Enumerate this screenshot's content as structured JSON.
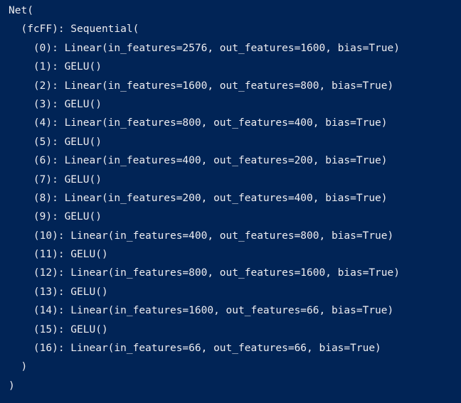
{
  "terminal": {
    "lines": [
      "Net(",
      "  (fcFF): Sequential(",
      "    (0): Linear(in_features=2576, out_features=1600, bias=True)",
      "    (1): GELU()",
      "    (2): Linear(in_features=1600, out_features=800, bias=True)",
      "    (3): GELU()",
      "    (4): Linear(in_features=800, out_features=400, bias=True)",
      "    (5): GELU()",
      "    (6): Linear(in_features=400, out_features=200, bias=True)",
      "    (7): GELU()",
      "    (8): Linear(in_features=200, out_features=400, bias=True)",
      "    (9): GELU()",
      "    (10): Linear(in_features=400, out_features=800, bias=True)",
      "    (11): GELU()",
      "    (12): Linear(in_features=800, out_features=1600, bias=True)",
      "    (13): GELU()",
      "    (14): Linear(in_features=1600, out_features=66, bias=True)",
      "    (15): GELU()",
      "    (16): Linear(in_features=66, out_features=66, bias=True)",
      "  )",
      ")"
    ],
    "background_color": "#012456",
    "text_color": "#eeedf0"
  }
}
